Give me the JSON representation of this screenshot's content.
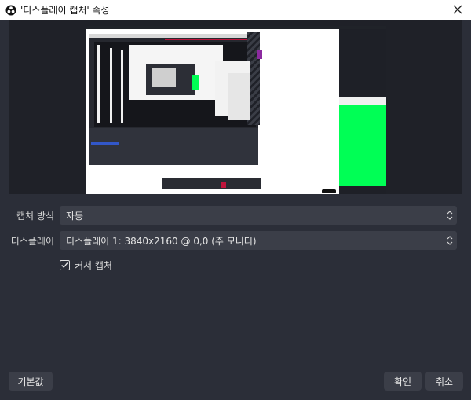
{
  "window": {
    "title": "'디스플레이 캡처' 속성",
    "app_icon": "obs-icon",
    "close_icon": "close-icon"
  },
  "form": {
    "capture_method": {
      "label": "캡처 방식",
      "value": "자동"
    },
    "display": {
      "label": "디스플레이",
      "value": "디스플레이 1: 3840x2160 @ 0,0 (주 모니터)"
    },
    "capture_cursor": {
      "label": "커서 캡처",
      "checked": true
    }
  },
  "buttons": {
    "defaults": "기본값",
    "ok": "확인",
    "cancel": "취소"
  },
  "colors": {
    "background": "#2b2e38",
    "preview_bg": "#1f2128",
    "control": "#3b3e48",
    "accent_green": "#00ff55",
    "accent_red": "#c0143c"
  }
}
